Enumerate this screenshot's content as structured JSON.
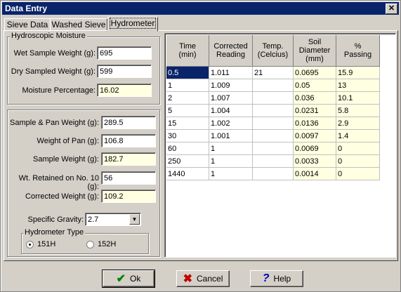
{
  "window": {
    "title": "Data Entry"
  },
  "tabs": [
    "Sieve Data",
    "Washed Sieve",
    "Hydrometer"
  ],
  "hygro": {
    "title": "Hydroscopic Moisture",
    "wet_label": "Wet Sample Weight (g):",
    "wet_value": "695",
    "dry_label": "Dry Sampled Weight (g):",
    "dry_value": "599",
    "moist_label": "Moisture Percentage:",
    "moist_value": "16.02"
  },
  "sample": {
    "pan_label": "Sample & Pan Weight (g):",
    "pan_value": "289.5",
    "wpan_label": "Weight of Pan (g):",
    "wpan_value": "106.8",
    "sw_label": "Sample Weight (g):",
    "sw_value": "182.7",
    "ret_label": "Wt. Retained on No. 10 (g):",
    "ret_value": "56",
    "cw_label": "Corrected Weight (g):",
    "cw_value": "109.2",
    "sg_label": "Specific Gravity:",
    "sg_value": "2.7"
  },
  "hydro_type": {
    "title": "Hydrometer Type",
    "opt1": "151H",
    "opt2": "152H",
    "selected": "151H"
  },
  "table": {
    "headers": [
      [
        "Time",
        "(min)"
      ],
      [
        "Corrected",
        "Reading"
      ],
      [
        "Temp.",
        "(Celcius)"
      ],
      [
        "Soil",
        "Diameter",
        "(mm)"
      ],
      [
        "%",
        "Passing"
      ]
    ],
    "rows": [
      [
        "0.5",
        "1.011",
        "21",
        "0.0695",
        "15.9"
      ],
      [
        "1",
        "1.009",
        "",
        "0.05",
        "13"
      ],
      [
        "2",
        "1.007",
        "",
        "0.036",
        "10.1"
      ],
      [
        "5",
        "1.004",
        "",
        "0.0231",
        "5.8"
      ],
      [
        "15",
        "1.002",
        "",
        "0.0136",
        "2.9"
      ],
      [
        "30",
        "1.001",
        "",
        "0.0097",
        "1.4"
      ],
      [
        "60",
        "1",
        "",
        "0.0069",
        "0"
      ],
      [
        "250",
        "1",
        "",
        "0.0033",
        "0"
      ],
      [
        "1440",
        "1",
        "",
        "0.0014",
        "0"
      ]
    ]
  },
  "buttons": {
    "ok": "Ok",
    "cancel": "Cancel",
    "help": "Help"
  },
  "colors": {
    "titlebar": "#0a246a",
    "readonly": "#ffffe1",
    "ok_check": "#008000",
    "cancel_x": "#c00000",
    "help_q": "#0000c0"
  }
}
